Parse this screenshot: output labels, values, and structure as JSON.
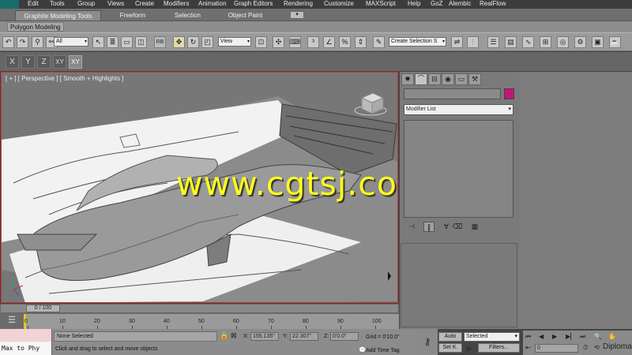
{
  "menu": {
    "items": [
      "Edit",
      "Tools",
      "Group",
      "Views",
      "Create",
      "Modifiers",
      "Animation",
      "Graph Editors",
      "Rendering",
      "Customize",
      "MAXScript",
      "Help",
      "GoZ",
      "Alembic",
      "RealFlow"
    ]
  },
  "ribbon": {
    "tabs": [
      "Graphite Modeling Tools",
      "Freeform",
      "Selection",
      "Object Paint"
    ],
    "panel_label": "Polygon Modeling"
  },
  "main_toolbar": {
    "selection_filter": "All",
    "reference_coord": "View",
    "named_selection_placeholder": "Create Selection S",
    "icons": [
      "undo-icon",
      "redo-icon",
      "link-icon",
      "unlink-icon",
      "bind-space-warp-icon",
      "select-object-icon",
      "select-by-name-icon",
      "rect-region-icon",
      "window-crossing-icon",
      "move-icon",
      "rotate-icon",
      "scale-icon",
      "pivot-icon",
      "manipulate-icon",
      "keyboard-shortcut-icon",
      "snap-toggle-icon",
      "angle-snap-icon",
      "percent-snap-icon",
      "spinner-snap-icon",
      "edit-named-selection-icon",
      "mirror-icon",
      "align-icon",
      "layer-manager-icon",
      "ribbon-toggle-icon",
      "curve-editor-icon",
      "schematic-view-icon",
      "material-editor-icon",
      "render-setup-icon",
      "rendered-frame-icon",
      "render-icon"
    ]
  },
  "axis_toolbar": {
    "buttons": [
      "X",
      "Y",
      "Z",
      "XY",
      "XY"
    ]
  },
  "viewport": {
    "label": "[ + ] [ Perspective ] [ Smooth + Highlights ]",
    "watermark": "www.cgtsj.com"
  },
  "command_panel": {
    "tabs": [
      "create-tab-icon",
      "modify-tab-icon",
      "hierarchy-tab-icon",
      "motion-tab-icon",
      "display-tab-icon",
      "utilities-tab-icon"
    ],
    "object_name": "",
    "object_color": "#c2167a",
    "modifier_list": "Modifier List"
  },
  "time_slider": {
    "position": "0 / 100",
    "ticks": [
      "0",
      "10",
      "20",
      "30",
      "40",
      "50",
      "60",
      "70",
      "80",
      "90",
      "100"
    ]
  },
  "status": {
    "maxscript_text": "Max to Phy",
    "selection": "None Selected",
    "prompt": "Click and drag to select and move objects",
    "x_label": "X:",
    "x_value": "155.135\"",
    "y_label": "Y:",
    "y_value": "22.307\"",
    "z_label": "Z:",
    "z_value": "0'0.0\"",
    "grid": "Grid = 0'10.0\"",
    "add_time_tag": "Add Time Tag"
  },
  "animation": {
    "auto_key": "Auto",
    "set_key": "Set K.",
    "key_filter_selection": "Selected",
    "filters": "Filters...",
    "current_frame": "0"
  },
  "brand_watermark": "Diploma"
}
